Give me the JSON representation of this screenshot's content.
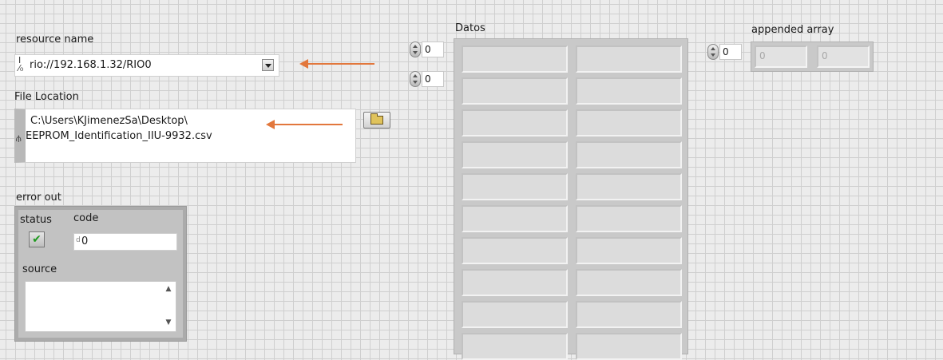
{
  "resource": {
    "label": "resource name",
    "io_icon": "I/O",
    "value": "rio://192.168.1.32/RIO0"
  },
  "file": {
    "label": "File Location",
    "path_icon": "path-icon",
    "line1": "C:\\Users\\KJimenezSa\\Desktop\\",
    "line2": "EEPROM_Identification_IIU-9932.csv"
  },
  "error": {
    "label": "error out",
    "status_label": "status",
    "code_label": "code",
    "code_value": "0",
    "source_label": "source",
    "status_mark": "✔",
    "status_color": "#1f9a1f"
  },
  "datos": {
    "label": "Datos",
    "index_row": "0",
    "index_col": "0",
    "rows": 10,
    "cols": 2
  },
  "appended": {
    "label": "appended array",
    "index": "0",
    "values": [
      "0",
      "0"
    ]
  },
  "annotation": {
    "arrow_color": "#e2773c"
  }
}
